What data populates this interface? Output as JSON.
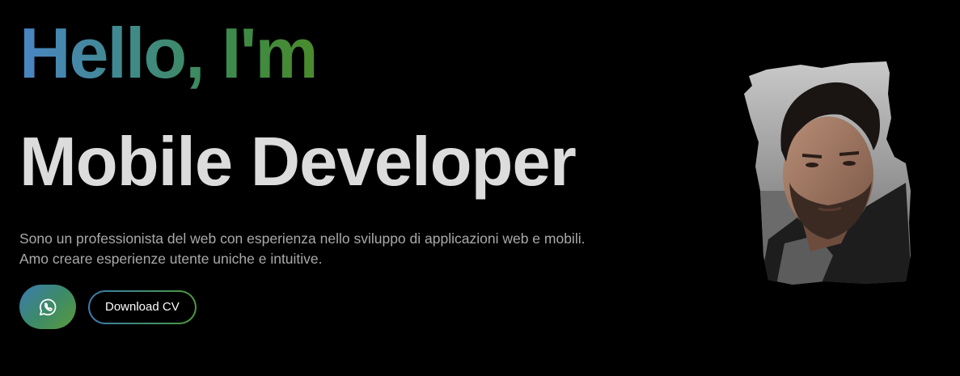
{
  "hero": {
    "greeting": "Hello, I'm",
    "role": "Mobile Developer",
    "bio": "Sono un professionista del web con esperienza nello sviluppo di applicazioni web e mobili. Amo creare esperienze utente uniche e intuitive.",
    "whatsapp_icon": "whatsapp-icon",
    "download_cv_label": "Download CV",
    "portrait_icon": "profile-photo"
  },
  "colors": {
    "background": "#000000",
    "gradient_start": "#4a86c5",
    "gradient_end": "#4a8b2c",
    "role_text": "#dcdcdc",
    "bio_text": "#a9a9a9"
  }
}
